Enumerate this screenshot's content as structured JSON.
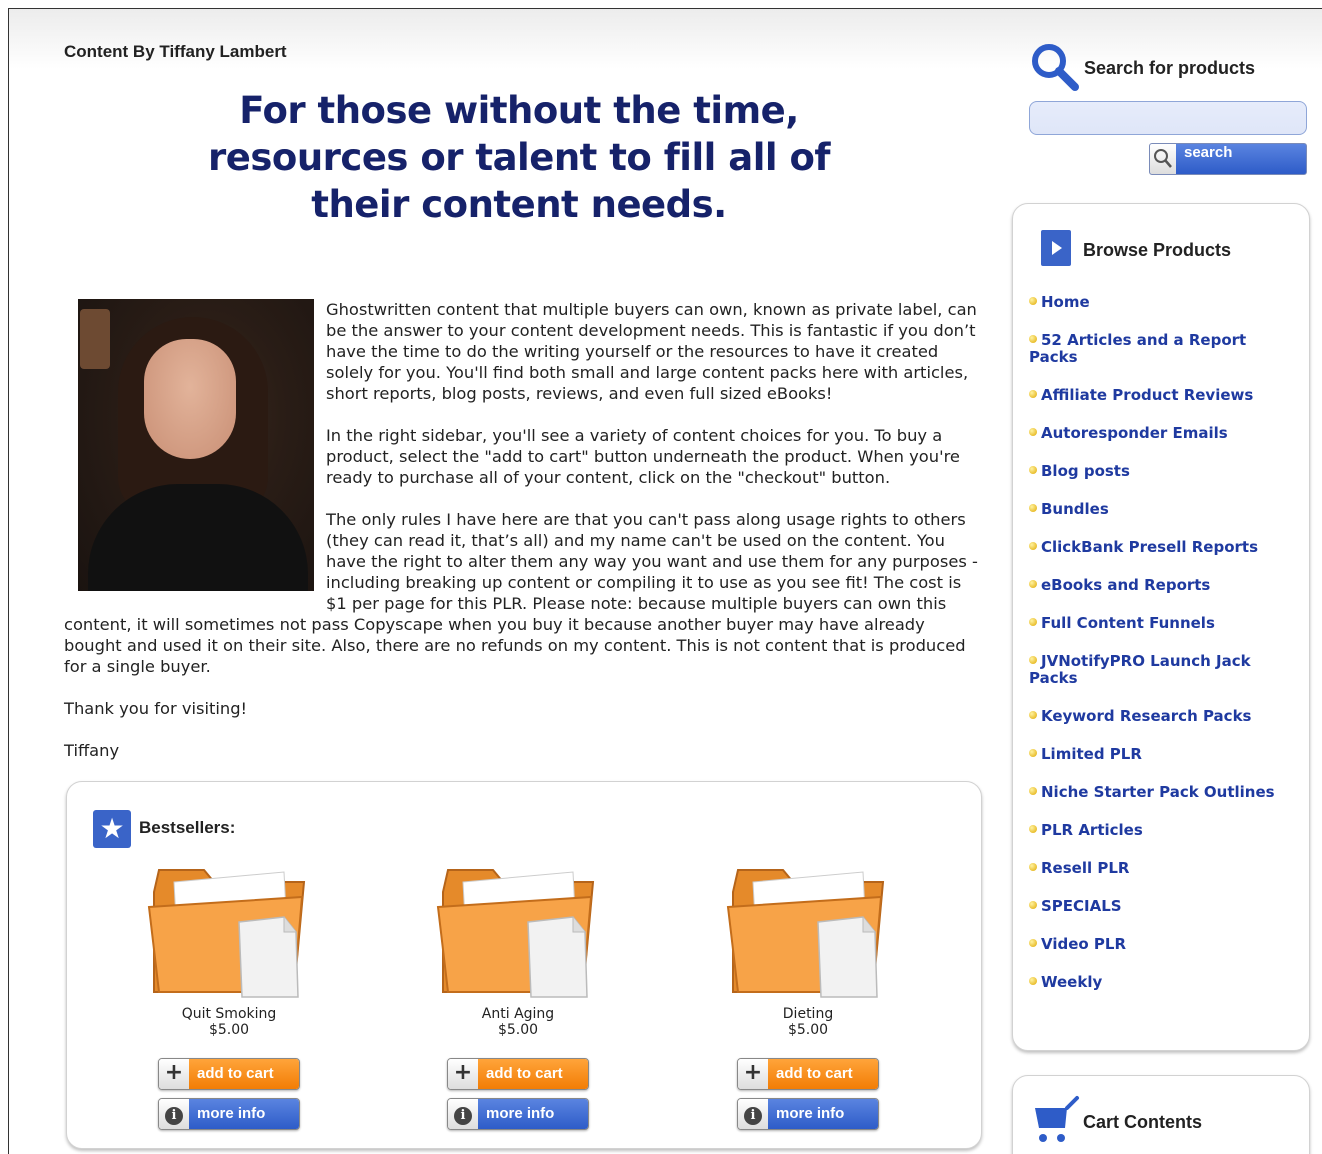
{
  "byline": "Content By Tiffany Lambert",
  "headline": {
    "line1": "For those without the time,",
    "line2": "resources or talent to fill all of",
    "line3": "their content needs."
  },
  "intro": {
    "p1": "Ghostwritten content that multiple buyers can own, known as private label, can be the answer to your content development needs. This is fantastic if you don’t have the time to do the writing yourself or the resources to have it created solely for you. You'll find both small and large content packs here with articles, short reports, blog posts, reviews, and even full sized eBooks!",
    "p2": "In the right sidebar, you'll see a variety of content choices for you. To buy a product, select the \"add to cart\" button underneath the product. When you're ready to purchase all of your content, click on the \"checkout\" button.",
    "p3": "The only rules I have here are that you can't pass along usage rights to others (they can read it, that’s all) and my name can't be used on the content. You have the right to alter them any way you want and use them for any purposes - including breaking up content or compiling it to use as you see fit! The cost is $1 per page for this PLR. Please note: because multiple buyers can own this content, it will sometimes not pass Copyscape when you buy it because another buyer may have already bought and used it on their site. Also, there are no refunds on my content. This is not content that is produced for a single buyer.",
    "p4": "Thank you for visiting!",
    "p5": "Tiffany"
  },
  "bestsellers": {
    "title": "Bestsellers:",
    "cart_label": "add to cart",
    "info_label": "more info",
    "products": [
      {
        "name": "Quit Smoking",
        "price": "$5.00"
      },
      {
        "name": "Anti Aging",
        "price": "$5.00"
      },
      {
        "name": "Dieting",
        "price": "$5.00"
      }
    ]
  },
  "search": {
    "title": "Search for products",
    "value": "",
    "button": "search"
  },
  "browse": {
    "title": "Browse Products",
    "items": [
      "Home",
      "52 Articles and a Report Packs",
      "Affiliate Product Reviews",
      "Autoresponder Emails",
      "Blog posts",
      "Bundles",
      "ClickBank Presell Reports",
      "eBooks and Reports",
      "Full Content Funnels",
      "JVNotifyPRO Launch Jack Packs",
      "Keyword Research Packs",
      "Limited PLR",
      "Niche Starter Pack Outlines",
      "PLR Articles",
      "Resell PLR",
      "SPECIALS",
      "Video PLR",
      "Weekly"
    ]
  },
  "cart": {
    "title": "Cart Contents"
  },
  "colors": {
    "headline": "#16226a",
    "link": "#1f3aa0",
    "accent_blue": "#3a64c8",
    "accent_orange": "#f27d05"
  }
}
